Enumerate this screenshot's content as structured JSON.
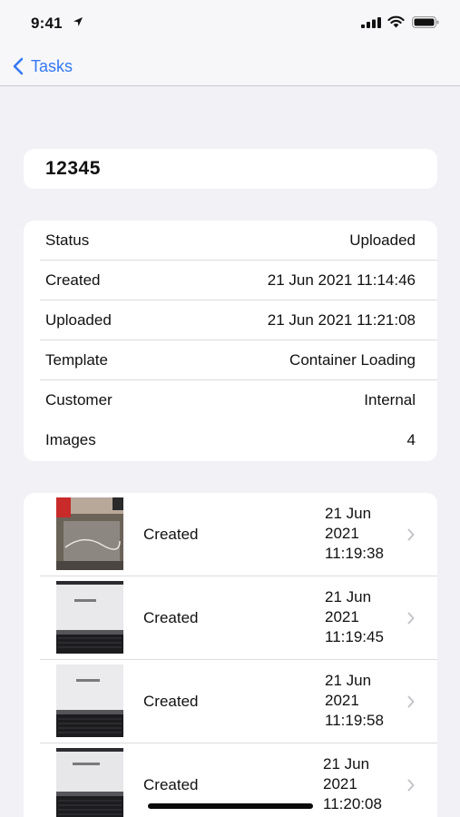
{
  "statusbar": {
    "time": "9:41"
  },
  "nav": {
    "back_label": "Tasks"
  },
  "task": {
    "title": "12345"
  },
  "details": [
    {
      "label": "Status",
      "value": "Uploaded"
    },
    {
      "label": "Created",
      "value": "21 Jun 2021 11:14:46"
    },
    {
      "label": "Uploaded",
      "value": "21 Jun 2021 11:21:08"
    },
    {
      "label": "Template",
      "value": "Container Loading"
    },
    {
      "label": "Customer",
      "value": "Internal"
    },
    {
      "label": "Images",
      "value": "4"
    }
  ],
  "images": [
    {
      "caption": "Created",
      "date_line1": "21 Jun",
      "date_line2": "2021",
      "date_line3": "11:19:38"
    },
    {
      "caption": "Created",
      "date_line1": "21 Jun",
      "date_line2": "2021",
      "date_line3": "11:19:45"
    },
    {
      "caption": "Created",
      "date_line1": "21 Jun",
      "date_line2": "2021",
      "date_line3": "11:19:58"
    },
    {
      "caption": "Created",
      "date_line1": "21 Jun",
      "date_line2": "2021",
      "date_line3": "11:20:08"
    }
  ],
  "colors": {
    "accent": "#3478f6",
    "background": "#f1f1f6",
    "card": "#ffffff"
  }
}
